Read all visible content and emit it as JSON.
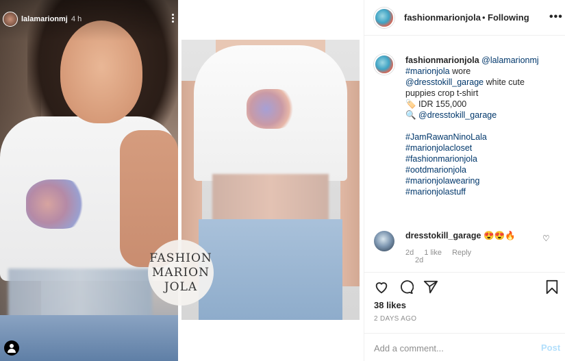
{
  "story": {
    "username": "lalamarionmj",
    "time": "4 h"
  },
  "badge": {
    "line1": "FASHION",
    "line2": "MARION",
    "line3": "JOLA"
  },
  "header": {
    "username": "fashionmarionjola",
    "separator": "•",
    "follow_status": "Following",
    "more_icon": "•••"
  },
  "caption": {
    "username": "fashionmarionjola",
    "mention": "@lalamarionmj",
    "lines": [
      {
        "text": "#marionjola",
        "type": "link",
        "suffix": " wore"
      },
      {
        "text": "@dresstokill_garage",
        "type": "link",
        "suffix": " white cute"
      },
      {
        "text": "puppies crop t-shirt",
        "type": "text"
      },
      {
        "text": "🏷️ IDR 155,000",
        "type": "text"
      },
      {
        "text": "🔍 ",
        "type": "text",
        "link": "@dresstokill_garage"
      }
    ],
    "hashtags": [
      "#JamRawanNinoLala",
      "#marionjolacloset",
      "#fashionmarionjola",
      "#ootdmarionjola",
      "#marionjolawearing",
      "#marionjolastuff"
    ],
    "age": "2d"
  },
  "comment": {
    "username": "dresstokill_garage",
    "text": "😍😍🔥",
    "age": "2d",
    "likes": "1 like",
    "reply": "Reply"
  },
  "actions": {
    "likes": "38 likes",
    "date": "2 DAYS AGO"
  },
  "add_comment": {
    "placeholder": "Add a comment...",
    "post_label": "Post"
  }
}
